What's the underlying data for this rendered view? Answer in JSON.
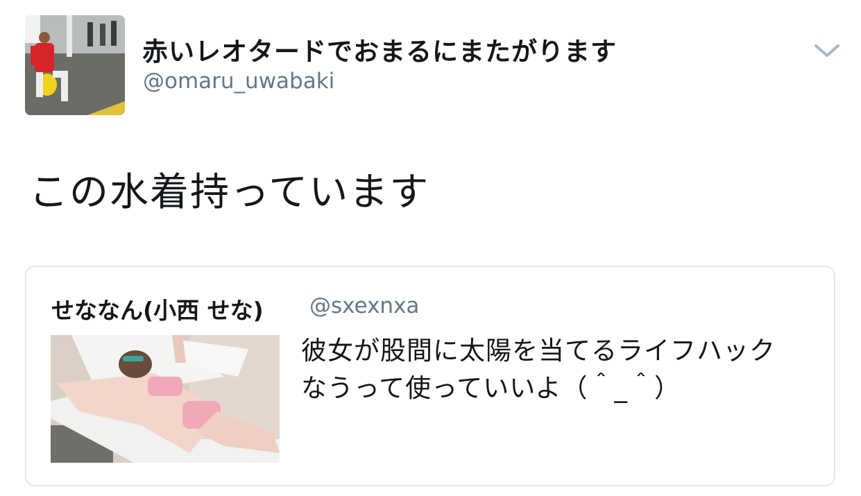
{
  "tweet": {
    "display_name": "赤いレオタードでおまるにまたがります",
    "handle": "@omaru_uwabaki",
    "text": "この水着持っています",
    "avatar_icon": "profile-photo",
    "menu_icon": "chevron-down-icon"
  },
  "quoted_tweet": {
    "display_name": "せななん(小西 せな)",
    "handle": "@sxexnxa",
    "text": "彼女が股間に太陽を当てるライフハックなうって使っていいよ（＾_＾）",
    "media_icon": "attached-photo"
  },
  "colors": {
    "text_primary": "#14171a",
    "text_secondary": "#657786",
    "border": "#e1e8ed"
  }
}
